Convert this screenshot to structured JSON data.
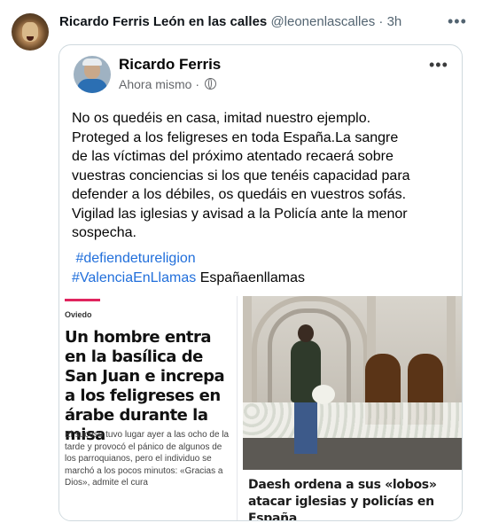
{
  "tweet": {
    "author_name": "Ricardo Ferris León en las calles",
    "handle": "@leonenlascalles",
    "separator": "·",
    "time": "3h",
    "more_label": "•••"
  },
  "fb_post": {
    "author": "Ricardo Ferris",
    "time": "Ahora mismo",
    "separator": "·",
    "more_label": "•••",
    "text_lines": [
      "No os quedéis en casa, imitad nuestro ejemplo.",
      "Proteged a los feligreses en toda España.La sangre",
      "de las víctimas del próximo atentado recaerá sobre",
      "vuestras conciencias si los que tenéis capacidad para",
      "defender a los débiles, os quedáis en vuestros sofás.",
      " Vigilad las iglesias y avisad a la Policía ante la menor",
      "sospecha."
    ],
    "hashtag_1": "#defiendetureligion",
    "hashtag_2": "#ValenciaEnLlamas",
    "trailing_text": "Españaenllamas"
  },
  "news_clip": {
    "section": "Oviedo",
    "headline": "Un hombre entra en la basílica de San Juan e increpa a los feligreses en árabe durante la misa",
    "summary": "El suceso tuvo lugar ayer a las ocho de la tarde y provocó el pánico de algunos de los parroquianos, pero el individuo se marchó a los pocos minutos: «Gracias a Dios», admite el cura"
  },
  "photo_clip": {
    "caption": "Daesh ordena a sus «lobos» atacar iglesias y policías en España"
  },
  "colors": {
    "hashtag": "#216fdb",
    "secondary_text": "#536471",
    "card_border": "#cfd9de",
    "news_accent": "#e0245e"
  }
}
